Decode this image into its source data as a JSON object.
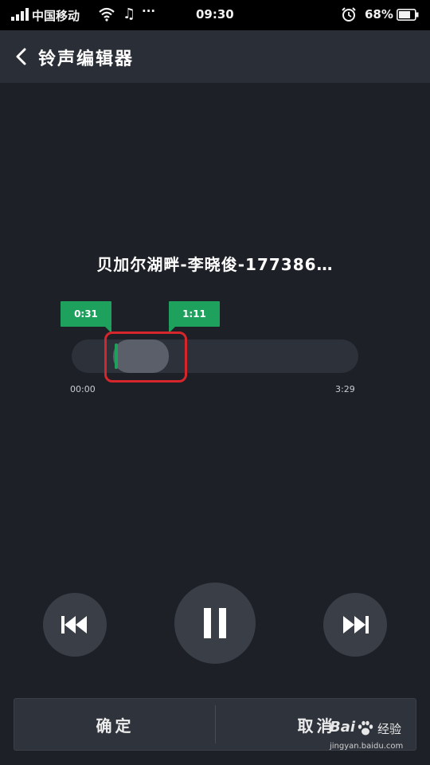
{
  "status_bar": {
    "carrier": "中国移动",
    "dots": "···",
    "time": "09:30",
    "battery": "68%",
    "icons": [
      "signal-icon",
      "wifi-icon",
      "music-note-icon",
      "alarm-icon",
      "battery-icon"
    ]
  },
  "header": {
    "back_icon": "chevron-left-icon",
    "title": "铃声编辑器"
  },
  "song": {
    "title": "贝加尔湖畔-李晓俊-177386…"
  },
  "editor": {
    "start_marker": "0:31",
    "end_marker": "1:11",
    "time_start": "00:00",
    "time_end": "3:29",
    "accent_color": "#1fa15e",
    "highlight_color": "#d6262b"
  },
  "controls": {
    "prev_icon": "skip-previous-icon",
    "pause_icon": "pause-icon",
    "next_icon": "skip-next-icon"
  },
  "actions": {
    "confirm": "确定",
    "cancel": "取消"
  },
  "watermark": {
    "brand": "Bai",
    "brand_cn": "经验",
    "url": "jingyan.baidu.com"
  }
}
